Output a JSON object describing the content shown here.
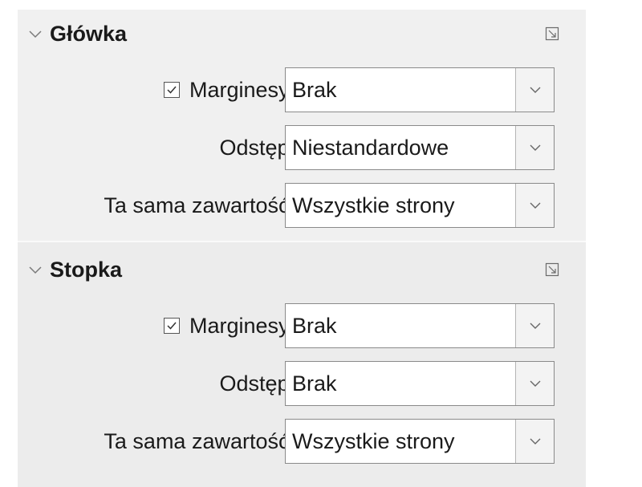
{
  "header_section": {
    "title": "Główka",
    "margins": {
      "label": "Marginesy:",
      "checked": true,
      "value": "Brak"
    },
    "spacing": {
      "label": "Odstęp:",
      "value": "Niestandardowe"
    },
    "same_content": {
      "label": "Ta sama zawartość:",
      "value": "Wszystkie strony"
    }
  },
  "footer_section": {
    "title": "Stopka",
    "margins": {
      "label": "Marginesy:",
      "checked": true,
      "value": "Brak"
    },
    "spacing": {
      "label": "Odstęp:",
      "value": "Brak"
    },
    "same_content": {
      "label": "Ta sama zawartość:",
      "value": "Wszystkie strony"
    }
  },
  "icons": {
    "collapse": "chevron-down-icon",
    "more_options": "more-options-icon",
    "dropdown": "dropdown-arrow-icon",
    "checkbox": "checkmark-icon"
  },
  "colors": {
    "panel_bg": "#f0f0f0",
    "field_border": "#8a8a8a",
    "text": "#1a1a1a"
  }
}
